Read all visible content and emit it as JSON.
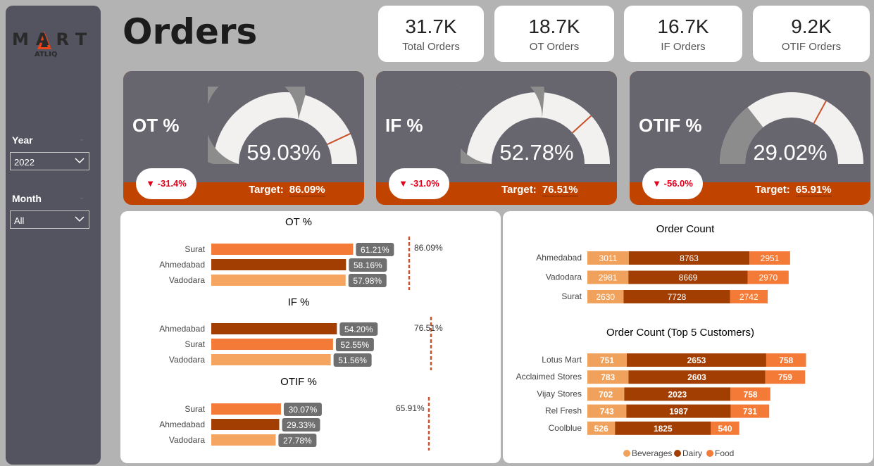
{
  "logo": {
    "brand": "MART",
    "sub": "ATLIQ"
  },
  "page_title": "Orders",
  "filters": {
    "year_label": "Year",
    "year_value": "2022",
    "month_label": "Month",
    "month_value": "All"
  },
  "kpis": [
    {
      "value": "31.7K",
      "label": "Total Orders"
    },
    {
      "value": "18.7K",
      "label": "OT Orders"
    },
    {
      "value": "16.7K",
      "label": "IF Orders"
    },
    {
      "value": "9.2K",
      "label": "OTIF Orders"
    }
  ],
  "gauges": [
    {
      "label": "OT %",
      "value_text": "59.03%",
      "value": 59.03,
      "target": 86.09,
      "change": "-31.4%",
      "target_label": "Target:",
      "target_text": "86.09%"
    },
    {
      "label": "IF %",
      "value_text": "52.78%",
      "value": 52.78,
      "target": 76.51,
      "change": "-31.0%",
      "target_label": "Target:",
      "target_text": "76.51%"
    },
    {
      "label": "OTIF %",
      "value_text": "29.02%",
      "value": 29.02,
      "target": 65.91,
      "change": "-56.0%",
      "target_label": "Target:",
      "target_text": "65.91%"
    }
  ],
  "colors": {
    "beverages": "#f0a25c",
    "dairy": "#a23e02",
    "food": "#f47b37",
    "bar_surat": "#f47b37",
    "bar_ahmedabad": "#a23e02",
    "bar_vadodara": "#f5a55f",
    "label_box": "#6f6f6f",
    "gauge_fill": "#8c8c8c",
    "gauge_bg": "#f2f1ef",
    "target_line": "#c9522a"
  },
  "chart_data": [
    {
      "type": "bar",
      "title": "OT %",
      "categories": [
        "Surat",
        "Ahmedabad",
        "Vadodara"
      ],
      "values": [
        61.21,
        58.16,
        57.98
      ],
      "labels": [
        "61.21%",
        "58.16%",
        "57.98%"
      ],
      "target": 86.09,
      "target_label": "86.09%"
    },
    {
      "type": "bar",
      "title": "IF %",
      "categories": [
        "Ahmedabad",
        "Surat",
        "Vadodara"
      ],
      "values": [
        54.2,
        52.55,
        51.56
      ],
      "labels": [
        "54.20%",
        "52.55%",
        "51.56%"
      ],
      "target": 76.51,
      "target_label": "76.51%"
    },
    {
      "type": "bar",
      "title": "OTIF %",
      "categories": [
        "Surat",
        "Ahmedabad",
        "Vadodara"
      ],
      "values": [
        30.07,
        29.33,
        27.78
      ],
      "labels": [
        "30.07%",
        "29.33%",
        "27.78%"
      ],
      "target": 65.91,
      "target_label": "65.91%"
    },
    {
      "type": "bar",
      "stacked": true,
      "title": "Order Count",
      "categories": [
        "Ahmedabad",
        "Vadodara",
        "Surat"
      ],
      "series": [
        {
          "name": "Beverages",
          "values": [
            3011,
            2981,
            2630
          ]
        },
        {
          "name": "Dairy",
          "values": [
            8763,
            8669,
            7728
          ]
        },
        {
          "name": "Food",
          "values": [
            2951,
            2970,
            2742
          ]
        }
      ]
    },
    {
      "type": "bar",
      "stacked": true,
      "title": "Order Count (Top 5 Customers)",
      "categories": [
        "Lotus Mart",
        "Acclaimed Stores",
        "Vijay Stores",
        "Rel Fresh",
        "Coolblue"
      ],
      "series": [
        {
          "name": "Beverages",
          "values": [
            751,
            783,
            702,
            743,
            526
          ]
        },
        {
          "name": "Dairy",
          "values": [
            2653,
            2603,
            2023,
            1987,
            1825
          ]
        },
        {
          "name": "Food",
          "values": [
            758,
            759,
            758,
            731,
            540
          ]
        }
      ],
      "legend": "bottom"
    }
  ]
}
